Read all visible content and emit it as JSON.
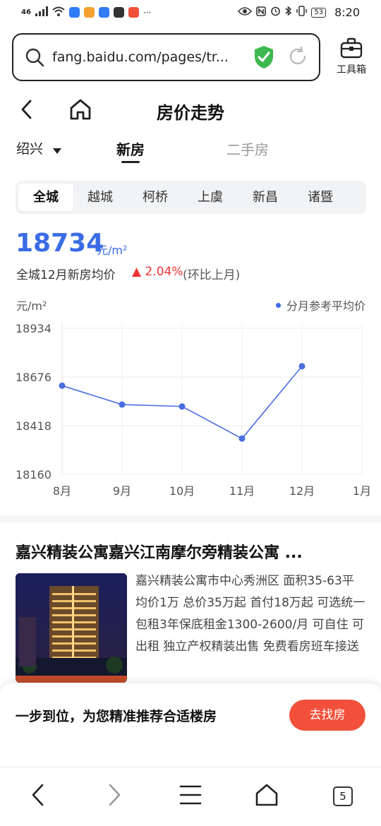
{
  "status_bar": {
    "network": "46",
    "time": "8:20",
    "battery": "53",
    "overflow": "···",
    "app_colors": [
      "#2f7cf6",
      "#f6a12f",
      "#2f7cf6",
      "#333333",
      "#f2503a"
    ]
  },
  "browser": {
    "url": "fang.baidu.com/pages/tr...",
    "toolbox_label": "工具箱",
    "security_color": "#3db84f"
  },
  "header": {
    "title": "房价走势",
    "city": "绍兴",
    "tabs": [
      "新房",
      "二手房"
    ]
  },
  "districts": [
    "全城",
    "越城",
    "柯桥",
    "上虞",
    "新昌",
    "诸暨"
  ],
  "price": {
    "value": "18734",
    "unit": "元/m²",
    "description": "全城12月新房均价",
    "change": "▲ 2.04%",
    "change_note": "(环比上月)"
  },
  "chart_data": {
    "type": "line",
    "ylabel": "元/m²",
    "legend": "分月参考平均价",
    "legend_position": "top-right",
    "categories": [
      "8月",
      "9月",
      "10月",
      "11月",
      "12月",
      "1月"
    ],
    "series": [
      {
        "name": "分月参考平均价",
        "values": [
          18630,
          18530,
          18520,
          18350,
          18733,
          null
        ]
      }
    ],
    "yticks": [
      "18934",
      "18676",
      "18418",
      "18160"
    ],
    "ylim": [
      18160,
      18934
    ],
    "color": "#4a6ee0"
  },
  "listing": {
    "title": "嘉兴精装公寓嘉兴江南摩尔旁精装公寓 ...",
    "description": "嘉兴精装公寓市中心秀洲区 面积35-63平 均价1万 总价35万起 首付18万起 可选统一包租3年保底租金1300-2600/月 可自住 可出租 独立产权精装出售 免费看房班车接送"
  },
  "recommend": {
    "text": "一步到位，为您精准推荐合适楼房",
    "button": "去找房"
  },
  "bottom_nav": {
    "tab_count": "5"
  }
}
